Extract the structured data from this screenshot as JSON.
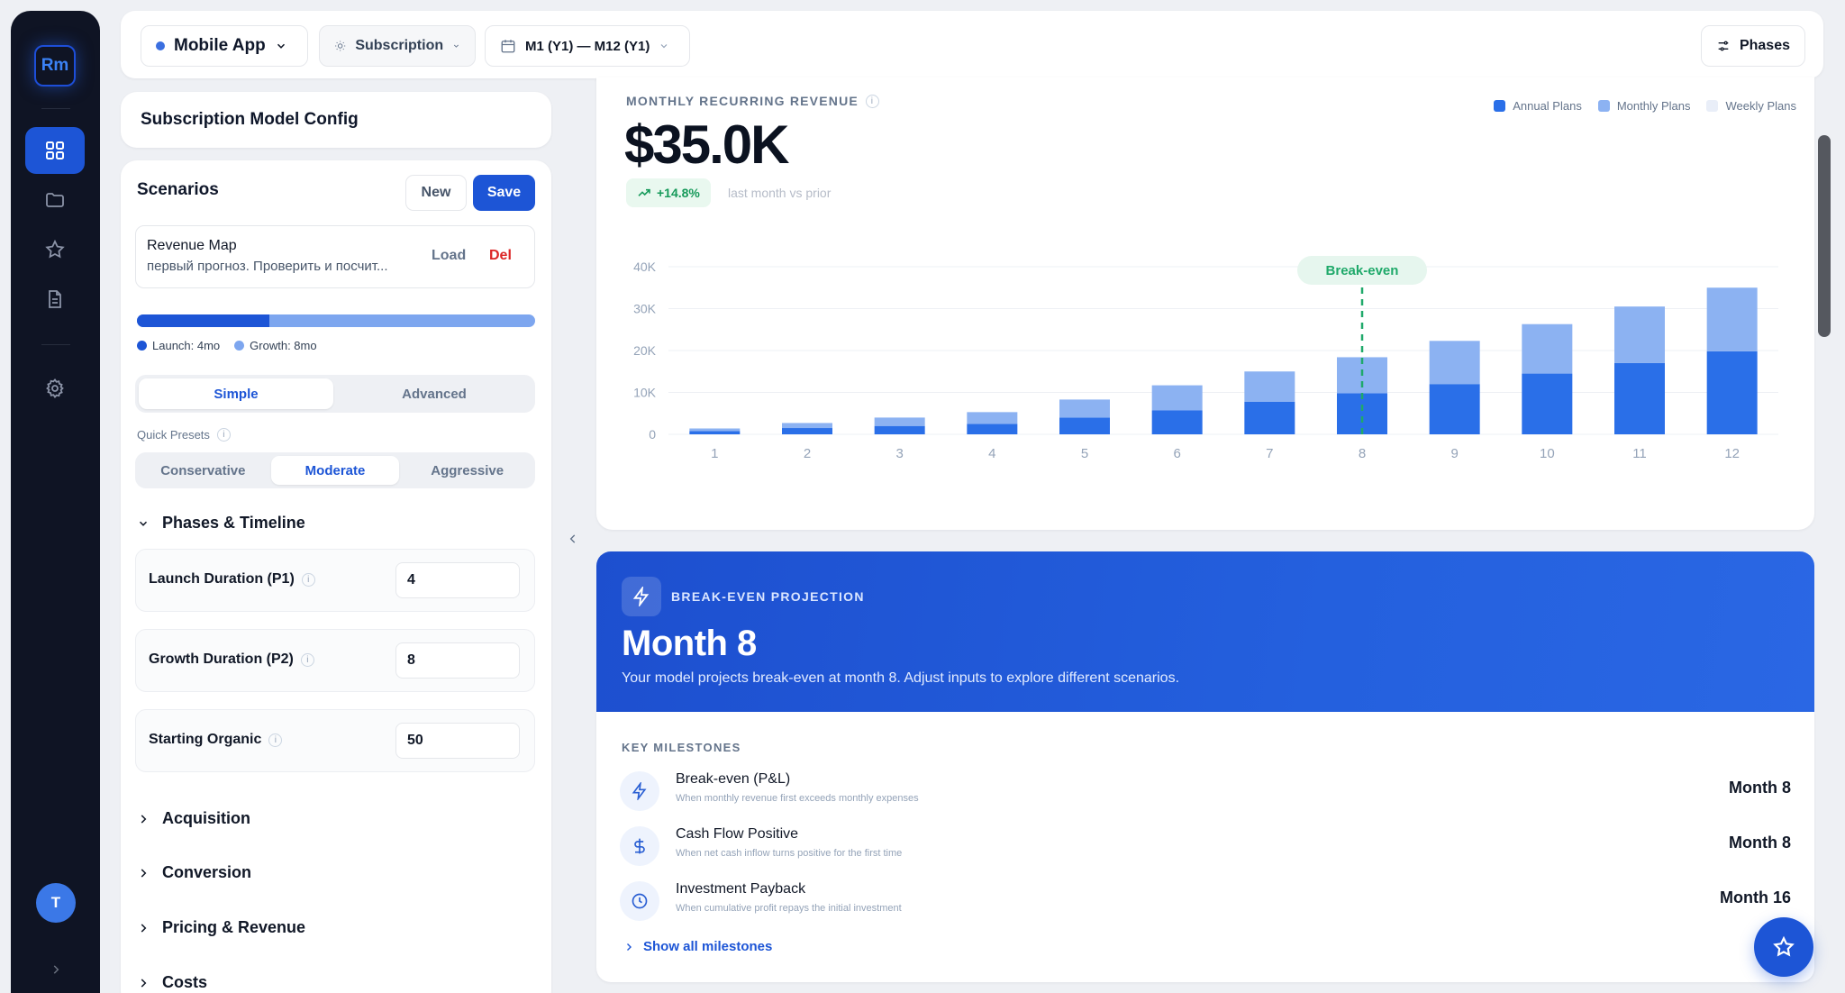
{
  "sidebar": {
    "logo": "Rm",
    "avatar": "T",
    "icons": [
      "grid-icon",
      "folder-icon",
      "star-icon",
      "document-icon",
      "gear-icon"
    ]
  },
  "topbar": {
    "app": "Mobile App",
    "model": "Subscription",
    "range": "M1 (Y1) — M12 (Y1)",
    "phases": "Phases"
  },
  "config": {
    "title": "Subscription Model Config",
    "scenarios": {
      "title": "Scenarios",
      "new": "New",
      "save": "Save",
      "item": {
        "name": "Revenue Map",
        "desc": "первый прогноз. Проверить и посчит...",
        "load": "Load",
        "del": "Del"
      }
    },
    "phases_bar": {
      "launch_label": "Launch: 4mo",
      "growth_label": "Growth: 8mo",
      "launch_months": 4,
      "growth_months": 8
    },
    "mode": {
      "simple": "Simple",
      "advanced": "Advanced"
    },
    "presets": {
      "label": "Quick Presets",
      "conservative": "Conservative",
      "moderate": "Moderate",
      "aggressive": "Aggressive"
    },
    "phases_section": "Phases & Timeline",
    "fields": [
      {
        "label": "Launch Duration (P1)",
        "value": "4"
      },
      {
        "label": "Growth Duration (P2)",
        "value": "8"
      },
      {
        "label": "Starting Organic",
        "value": "50"
      }
    ],
    "sections": [
      "Acquisition",
      "Conversion",
      "Pricing & Revenue",
      "Costs"
    ]
  },
  "mrr": {
    "label": "MONTHLY RECURRING REVENUE",
    "value": "$35.0K",
    "change": "+14.8%",
    "change_note": "last month vs prior"
  },
  "chart_data": {
    "type": "bar",
    "stacked": true,
    "categories": [
      "1",
      "2",
      "3",
      "4",
      "5",
      "6",
      "7",
      "8",
      "9",
      "10",
      "11",
      "12"
    ],
    "series": [
      {
        "name": "Annual Plans",
        "color": "#2a6fe8",
        "values": [
          0.8,
          1.5,
          2.0,
          2.5,
          4.0,
          5.7,
          7.8,
          9.8,
          12.0,
          14.5,
          17.0,
          19.8
        ]
      },
      {
        "name": "Monthly Plans",
        "color": "#8cb2f2",
        "values": [
          0.6,
          1.2,
          2.0,
          2.8,
          4.3,
          6.0,
          7.2,
          8.6,
          10.3,
          11.8,
          13.5,
          15.2
        ]
      },
      {
        "name": "Weekly Plans",
        "color": "#e9eef8",
        "values": [
          0,
          0,
          0,
          0,
          0,
          0,
          0,
          0,
          0,
          0,
          0,
          0
        ]
      }
    ],
    "yticks": [
      "40K",
      "30K",
      "20K",
      "10K",
      "0"
    ],
    "ylim": [
      0,
      40
    ],
    "grid": true,
    "legend_position": "top-right",
    "annotation": {
      "label": "Break-even",
      "at_category": "8",
      "color": "#1fa96a"
    }
  },
  "breakeven": {
    "label": "BREAK-EVEN PROJECTION",
    "title": "Month 8",
    "desc": "Your model projects break-even at month 8. Adjust inputs to explore different scenarios."
  },
  "milestones": {
    "label": "KEY MILESTONES",
    "items": [
      {
        "title": "Break-even (P&L)",
        "sub": "When monthly revenue first exceeds monthly expenses",
        "value": "Month 8",
        "icon": "bolt-icon"
      },
      {
        "title": "Cash Flow Positive",
        "sub": "When net cash inflow turns positive for the first time",
        "value": "Month 8",
        "icon": "dollar-icon"
      },
      {
        "title": "Investment Payback",
        "sub": "When cumulative profit repays the initial investment",
        "value": "Month 16",
        "icon": "clock-icon"
      }
    ],
    "show_all": "Show all milestones"
  }
}
